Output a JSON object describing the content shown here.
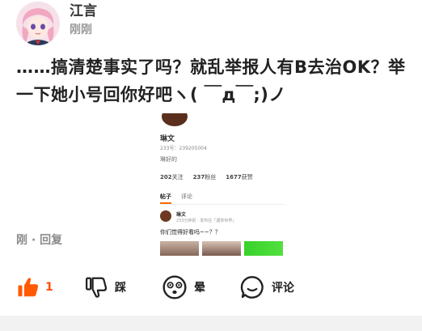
{
  "post": {
    "username": "江言",
    "time": "刚刚",
    "body": "……搞清楚事实了吗？就乱举报人有B去治OK？举一下她小号回你好吧ヽ( ￣д￣;)ノ"
  },
  "screenshot": {
    "profile_name": "琳文",
    "profile_id": "233号：239205004",
    "profile_bio": "琳好的",
    "stats": [
      {
        "value": "202",
        "label": "关注"
      },
      {
        "value": "237",
        "label": "粉丝"
      },
      {
        "value": "1677",
        "label": "获赞"
      }
    ],
    "tabs": [
      "帖子",
      "评论"
    ],
    "post_name": "琳文",
    "post_meta": "233分钟前 · 发布在「遇你世界」",
    "post_text": "你们觉得好看吗~~？？"
  },
  "comment_meta": "刚 · 回复",
  "actions": {
    "like_count": "1",
    "dislike_label": "踩",
    "wow_label": "晕",
    "comment_label": "评论"
  },
  "colors": {
    "accent": "#ff5a00",
    "text": "#222222",
    "muted": "#9a9a9a"
  },
  "icons": [
    "thumbs-up-icon",
    "thumbs-down-icon",
    "dizzy-face-icon",
    "comment-bubble-icon"
  ]
}
